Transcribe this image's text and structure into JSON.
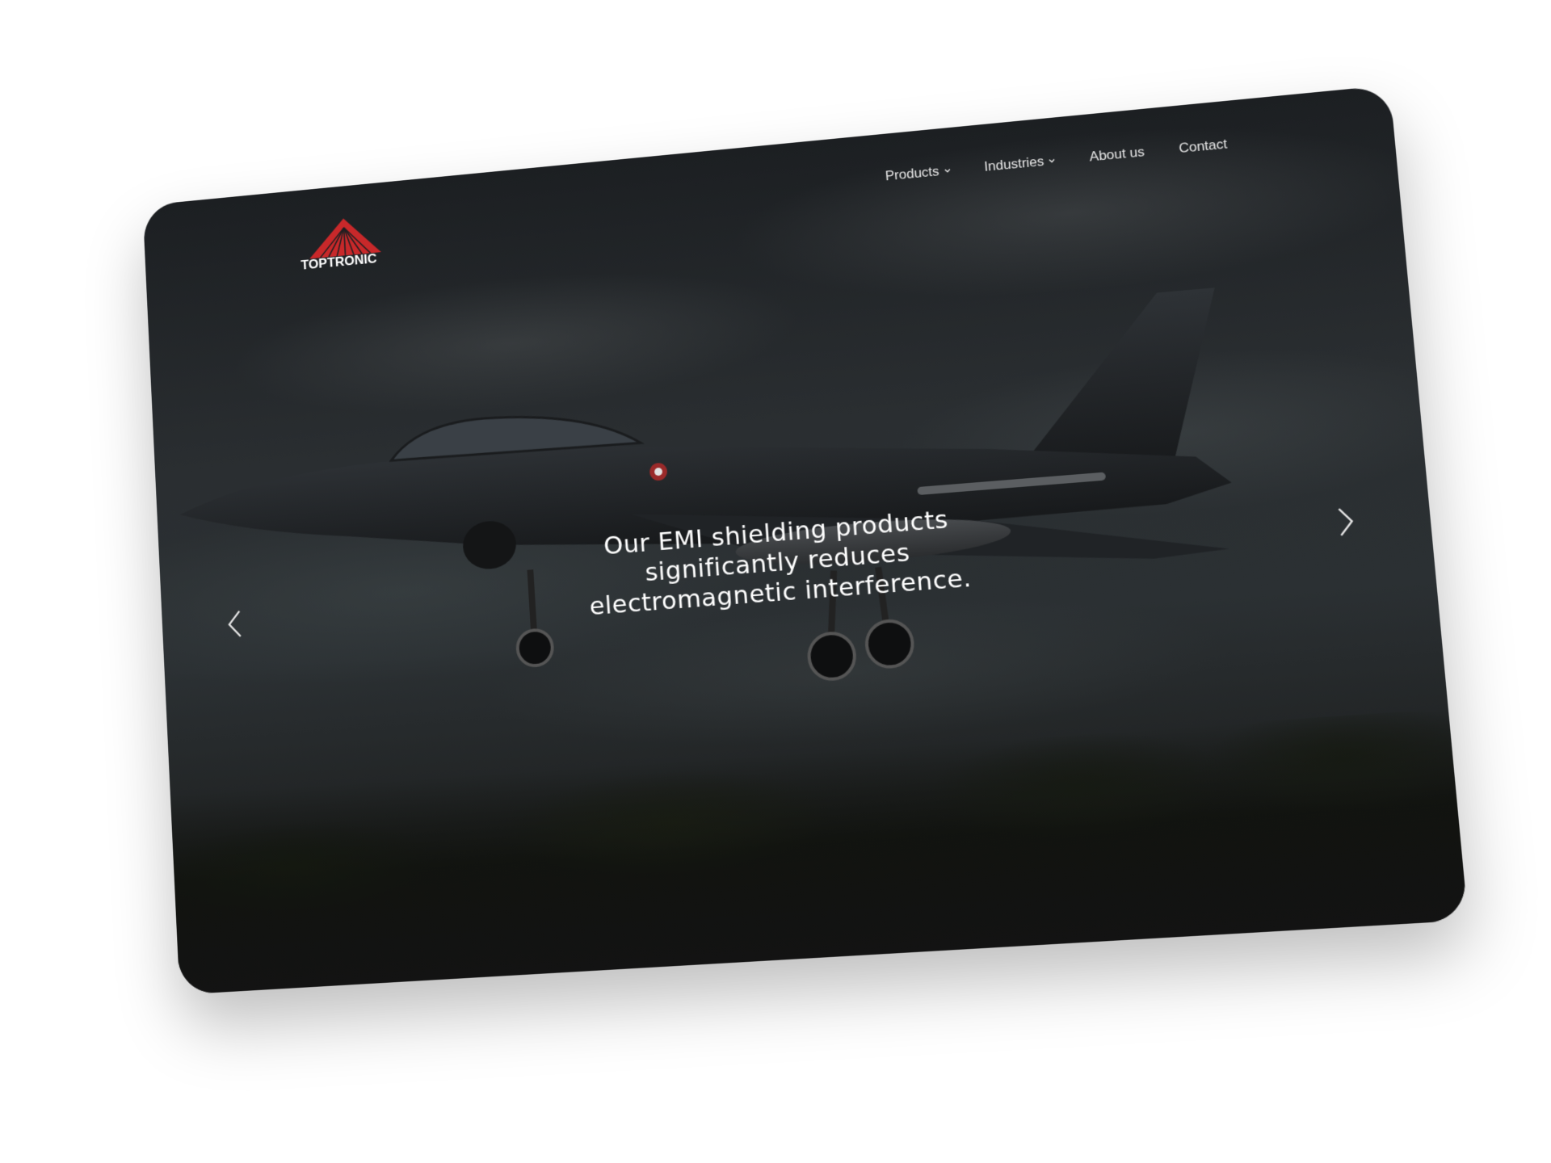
{
  "brand": {
    "name": "TOPTRONIC",
    "accent_color": "#c8282a"
  },
  "nav": {
    "items": [
      {
        "label": "Products",
        "has_dropdown": true
      },
      {
        "label": "Industries",
        "has_dropdown": true
      },
      {
        "label": "About us",
        "has_dropdown": false
      },
      {
        "label": "Contact",
        "has_dropdown": false
      }
    ]
  },
  "hero": {
    "line1": "Our EMI shielding products",
    "line2": "significantly reduces",
    "line3": "electromagnetic interference.",
    "background": "fighter-jet-photo"
  },
  "slider": {
    "prev_icon": "chevron-left-icon",
    "next_icon": "chevron-right-icon"
  }
}
